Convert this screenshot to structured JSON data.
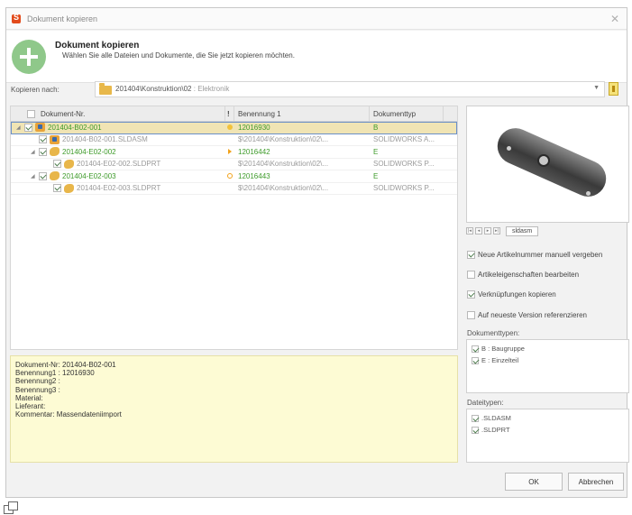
{
  "window": {
    "title": "Dokument kopieren"
  },
  "header": {
    "title": "Dokument kopieren",
    "subtitle": "Wählen Sie alle Dateien und Dokumente, die Sie jetzt kopieren möchten."
  },
  "copy_to": {
    "label": "Kopieren nach:",
    "path": "201404\\Konstruktion\\02",
    "path_suffix": ": Elektronik"
  },
  "grid": {
    "columns": [
      "Dokument-Nr.",
      "!",
      "Benennung 1",
      "Dokumenttyp"
    ],
    "rows": [
      {
        "name": "201404-B02-001",
        "benennung": "12016930",
        "typ": "B",
        "level": 0,
        "icon": "assembly-icon",
        "flag": "warn",
        "color": "green",
        "selected": true,
        "expanded": true
      },
      {
        "name": "201404-B02-001.SLDASM",
        "benennung": "$\\201404\\Konstruktion\\02\\...",
        "typ": "SOLIDWORKS A...",
        "level": 1,
        "icon": "assembly-icon",
        "flag": "",
        "color": "grey",
        "selected": false,
        "expanded": false
      },
      {
        "name": "201404-E02-002",
        "benennung": "12016442",
        "typ": "E",
        "level": 1,
        "icon": "part-icon",
        "flag": "arrow",
        "color": "green",
        "selected": false,
        "expanded": true
      },
      {
        "name": "201404-E02-002.SLDPRT",
        "benennung": "$\\201404\\Konstruktion\\02\\...",
        "typ": "SOLIDWORKS P...",
        "level": 2,
        "icon": "part-icon",
        "flag": "",
        "color": "grey",
        "selected": false,
        "expanded": false
      },
      {
        "name": "201404-E02-003",
        "benennung": "12016443",
        "typ": "E",
        "level": 1,
        "icon": "part-icon",
        "flag": "circle",
        "color": "green",
        "selected": false,
        "expanded": true
      },
      {
        "name": "201404-E02-003.SLDPRT",
        "benennung": "$\\201404\\Konstruktion\\02\\...",
        "typ": "SOLIDWORKS P...",
        "level": 2,
        "icon": "part-icon",
        "flag": "",
        "color": "grey",
        "selected": false,
        "expanded": false
      }
    ]
  },
  "info": {
    "lines": [
      "Dokument-Nr: 201404-B02-001",
      "Benennung1 : 12016930",
      "Benennung2 :",
      "Benennung3 :",
      "Material:",
      "Lieferant:",
      "Kommentar:  Massendateniimport"
    ]
  },
  "preview": {
    "tab_label": "sldasm"
  },
  "options": {
    "neue_artikelnummer": {
      "label": "Neue Artikelnummer manuell vergeben",
      "checked": true
    },
    "artikeleigenschaften": {
      "label": "Artikeleigenschaften bearbeiten",
      "checked": false
    },
    "verknuepfungen": {
      "label": "Verknüpfungen kopieren",
      "checked": true
    },
    "neueste_version": {
      "label": "Auf neueste Version referenzieren",
      "checked": false
    }
  },
  "dokumenttypen": {
    "label": "Dokumenttypen:",
    "items": [
      {
        "label": "B : Baugruppe",
        "checked": true
      },
      {
        "label": "E : Einzelteil",
        "checked": true
      }
    ]
  },
  "dateitypen": {
    "label": "Dateitypen:",
    "items": [
      {
        "label": ".SLDASM",
        "checked": true
      },
      {
        "label": ".SLDPRT",
        "checked": true
      }
    ]
  },
  "buttons": {
    "ok": "OK",
    "cancel": "Abbrechen"
  },
  "colors": {
    "green_text": "#3e9b2a",
    "selection": "#f0e4b4",
    "info_bg": "#fdfbd4",
    "accent": "#8fc88a"
  }
}
